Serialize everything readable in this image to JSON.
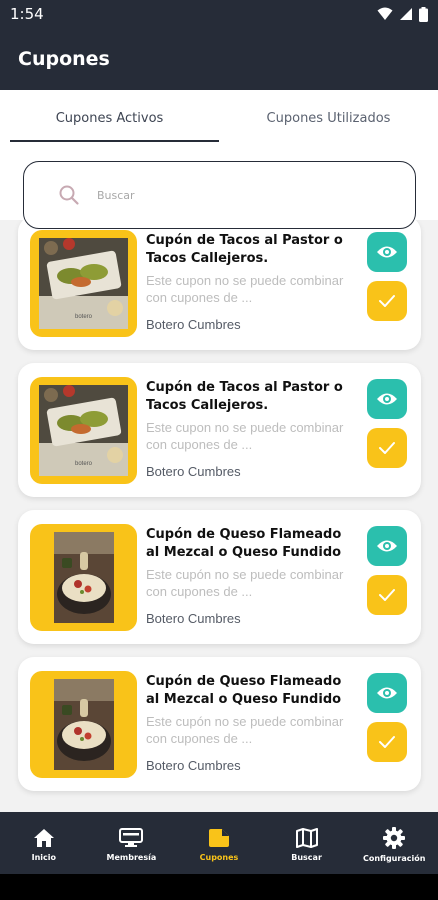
{
  "status_bar": {
    "time": "1:54",
    "icons": [
      "wifi-icon",
      "signal-icon",
      "battery-icon"
    ]
  },
  "app_bar": {
    "title": "Cupones"
  },
  "tabs": [
    {
      "label": "Cupones Activos",
      "active": true
    },
    {
      "label": "Cupones Utilizados",
      "active": false
    }
  ],
  "search": {
    "placeholder": "Buscar",
    "icon": "search-icon"
  },
  "coupons": [
    {
      "title": "Cupón de Tacos al Pastor o Tacos Callejeros.",
      "description": "Este cupon no se puede combinar con cupones de ...",
      "store": "Botero Cumbres",
      "image": "tacos-photo"
    },
    {
      "title": "Cupón de Tacos al Pastor o Tacos Callejeros.",
      "description": "Este cupon no se puede combinar con cupones de ...",
      "store": "Botero Cumbres",
      "image": "tacos-photo"
    },
    {
      "title": "Cupón de Queso Flameado al Mezcal o Queso Fundido con ...",
      "description": "Este cupón no se puede combinar con cupones de ...",
      "store": "Botero Cumbres",
      "image": "queso-photo"
    },
    {
      "title": "Cupón de Queso Flameado al Mezcal o Queso Fundido con ...",
      "description": "Este cupón no se puede combinar con cupones de ...",
      "store": "Botero Cumbres",
      "image": "queso-photo"
    }
  ],
  "bottom_nav": [
    {
      "label": "Inicio",
      "icon": "home-icon",
      "active": false
    },
    {
      "label": "Membresía",
      "icon": "membership-icon",
      "active": false
    },
    {
      "label": "Cupones",
      "icon": "coupon-icon",
      "active": true
    },
    {
      "label": "Buscar",
      "icon": "map-icon",
      "active": false
    },
    {
      "label": "Configuración",
      "icon": "gear-icon",
      "active": false
    }
  ],
  "colors": {
    "header": "#262c38",
    "accent_yellow": "#f9c319",
    "accent_teal": "#2bbfad",
    "background": "#f2f2f2"
  }
}
